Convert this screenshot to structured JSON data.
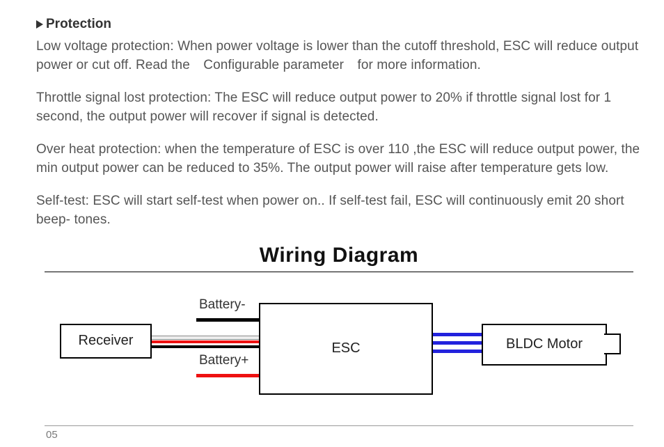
{
  "section": {
    "heading": "Protection"
  },
  "paragraphs": {
    "lowvoltage_a": "Low voltage protection: When power voltage is lower than the cutoff threshold, ESC will reduce output power or cut off. Read the",
    "lowvoltage_b": "Configurable parameter",
    "lowvoltage_c": "for more information.",
    "throttle": "Throttle signal lost protection: The ESC will reduce output power to 20% if throttle signal lost for 1 second, the output power will recover if signal is detected.",
    "overheat": "Over heat protection: when the temperature of ESC is over 110   ,the ESC will reduce output power, the min output power can be reduced to 35%. The output power will raise after temperature gets low.",
    "selftest": "Self-test: ESC will start self-test when power on.. If self-test fail, ESC will continuously emit 20 short   beep-   tones."
  },
  "diagram": {
    "title": "Wiring Diagram",
    "receiver_label": "Receiver",
    "esc_label": "ESC",
    "motor_label": "BLDC Motor",
    "battery_neg_label": "Battery-",
    "battery_pos_label": "Battery+"
  },
  "page_number": "05"
}
